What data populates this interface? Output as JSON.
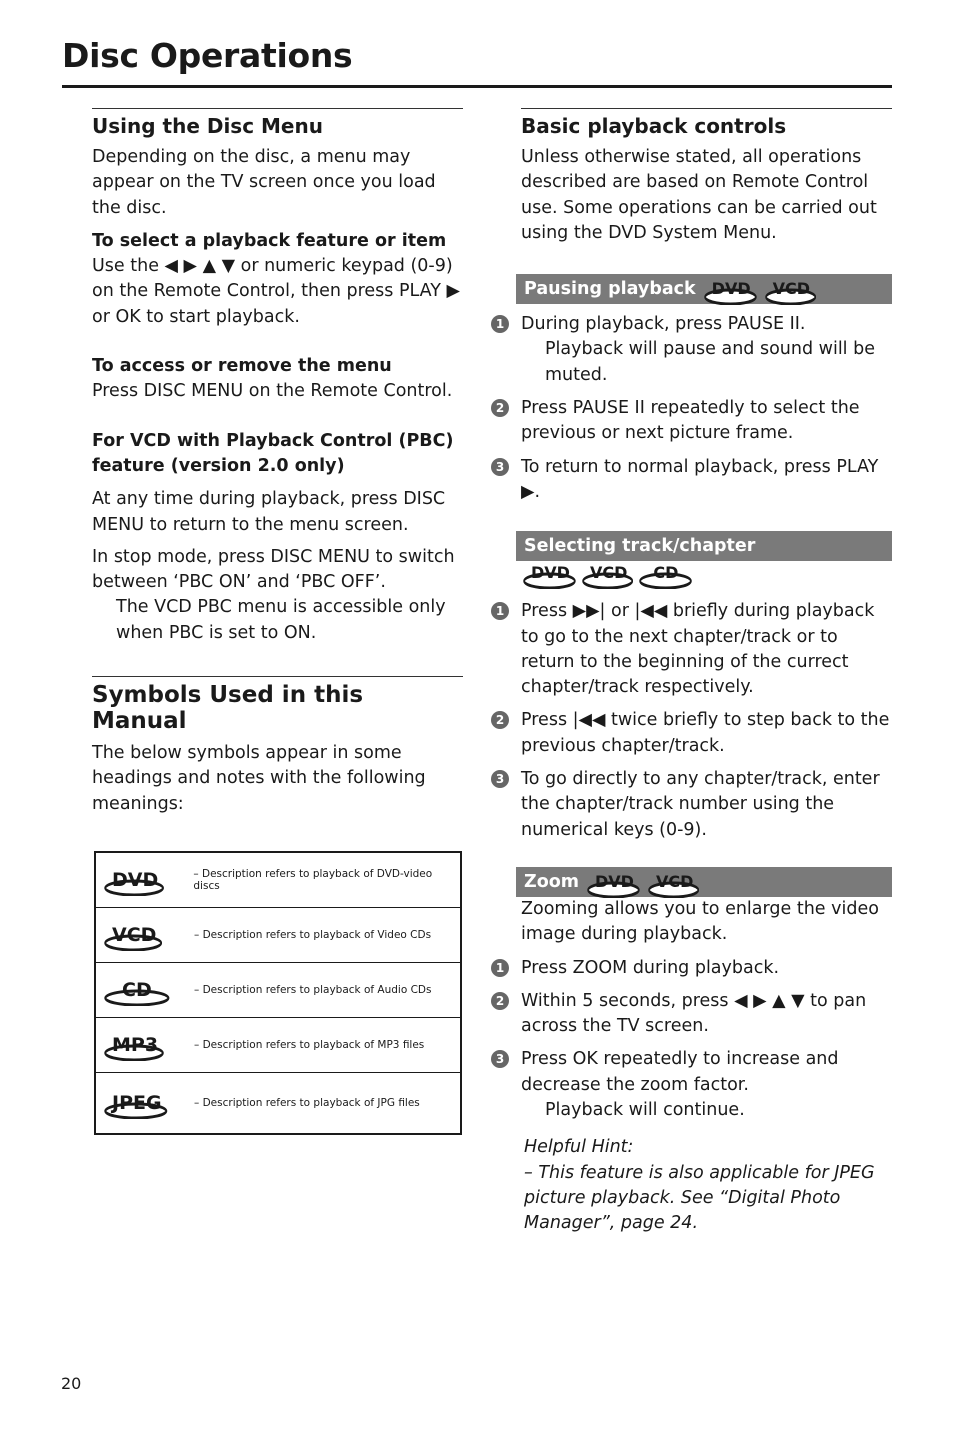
{
  "page": {
    "title": "Disc Operations",
    "number": "20"
  },
  "left": {
    "disc_menu": {
      "heading": "Using the Disc Menu",
      "intro": "Depending on the disc, a menu may appear on the TV screen once you load the disc.",
      "select_heading": "To select a playback feature or item",
      "select_text": "Use the ◀ ▶ ▲ ▼ or numeric keypad (0-9) on the Remote Control, then press PLAY ▶ or OK to start playback.",
      "access_heading": "To access or remove the menu",
      "access_text": "Press DISC MENU on the Remote Control.",
      "pbc_heading": "For VCD with Playback Control (PBC) feature (version 2.0 only)",
      "pbc_text1": "At any time during playback, press DISC MENU to return to the menu screen.",
      "pbc_text2": "In stop mode, press DISC MENU to switch between ‘PBC ON’ and ‘PBC OFF’.",
      "pbc_note": "The VCD PBC menu is accessible only when PBC is set to ON."
    },
    "symbols": {
      "heading": "Symbols Used in this Manual",
      "intro": "The below symbols appear in some headings and notes with the following meanings:",
      "rows": [
        {
          "logo": "DVD",
          "desc": "– Description refers to playback of DVD-video discs"
        },
        {
          "logo": "VCD",
          "desc": "– Description refers to playback of Video CDs"
        },
        {
          "logo": "CD",
          "desc": "– Description refers to playback of Audio CDs"
        },
        {
          "logo": "MP3",
          "desc": "– Description refers to playback of MP3 files"
        },
        {
          "logo": "JPEG",
          "desc": "– Description refers to playback of JPG files"
        }
      ]
    }
  },
  "right": {
    "basic": {
      "heading": "Basic playback controls",
      "intro": "Unless otherwise stated, all operations described are based on Remote Control use. Some operations can be carried out using the DVD System Menu."
    },
    "pausing": {
      "banner": "Pausing playback",
      "logos": [
        "DVD",
        "VCD"
      ],
      "steps": [
        {
          "n": "1",
          "text": "During playback, press PAUSE II.",
          "note": "Playback will pause and sound will be muted."
        },
        {
          "n": "2",
          "text": "Press PAUSE II repeatedly to select the previous or next picture frame."
        },
        {
          "n": "3",
          "text": "To return to normal playback, press PLAY ▶."
        }
      ]
    },
    "selecting": {
      "banner": "Selecting track/chapter",
      "logos": [
        "DVD",
        "VCD",
        "CD"
      ],
      "steps": [
        {
          "n": "1",
          "text": "Press ▶▶| or |◀◀ briefly during playback to go to the next chapter/track or to return to the beginning of the currect chapter/track respectively."
        },
        {
          "n": "2",
          "text": "Press |◀◀ twice briefly to step back to the previous chapter/track."
        },
        {
          "n": "3",
          "text": "To go directly to any chapter/track, enter the chapter/track number using the numerical keys (0-9)."
        }
      ]
    },
    "zoom": {
      "banner": "Zoom",
      "logos": [
        "DVD",
        "VCD"
      ],
      "intro": "Zooming allows you to enlarge the video image during playback.",
      "steps": [
        {
          "n": "1",
          "text": "Press ZOOM during playback."
        },
        {
          "n": "2",
          "text": "Within 5 seconds, press ◀ ▶ ▲ ▼ to pan across the TV screen."
        },
        {
          "n": "3",
          "text": "Press OK repeatedly to increase and decrease the zoom factor.",
          "note": "Playback will continue."
        }
      ],
      "hint_title": "Helpful Hint:",
      "hint_text": "–    This feature is also applicable for JPEG picture playback. See “Digital Photo Manager”, page 24."
    }
  }
}
